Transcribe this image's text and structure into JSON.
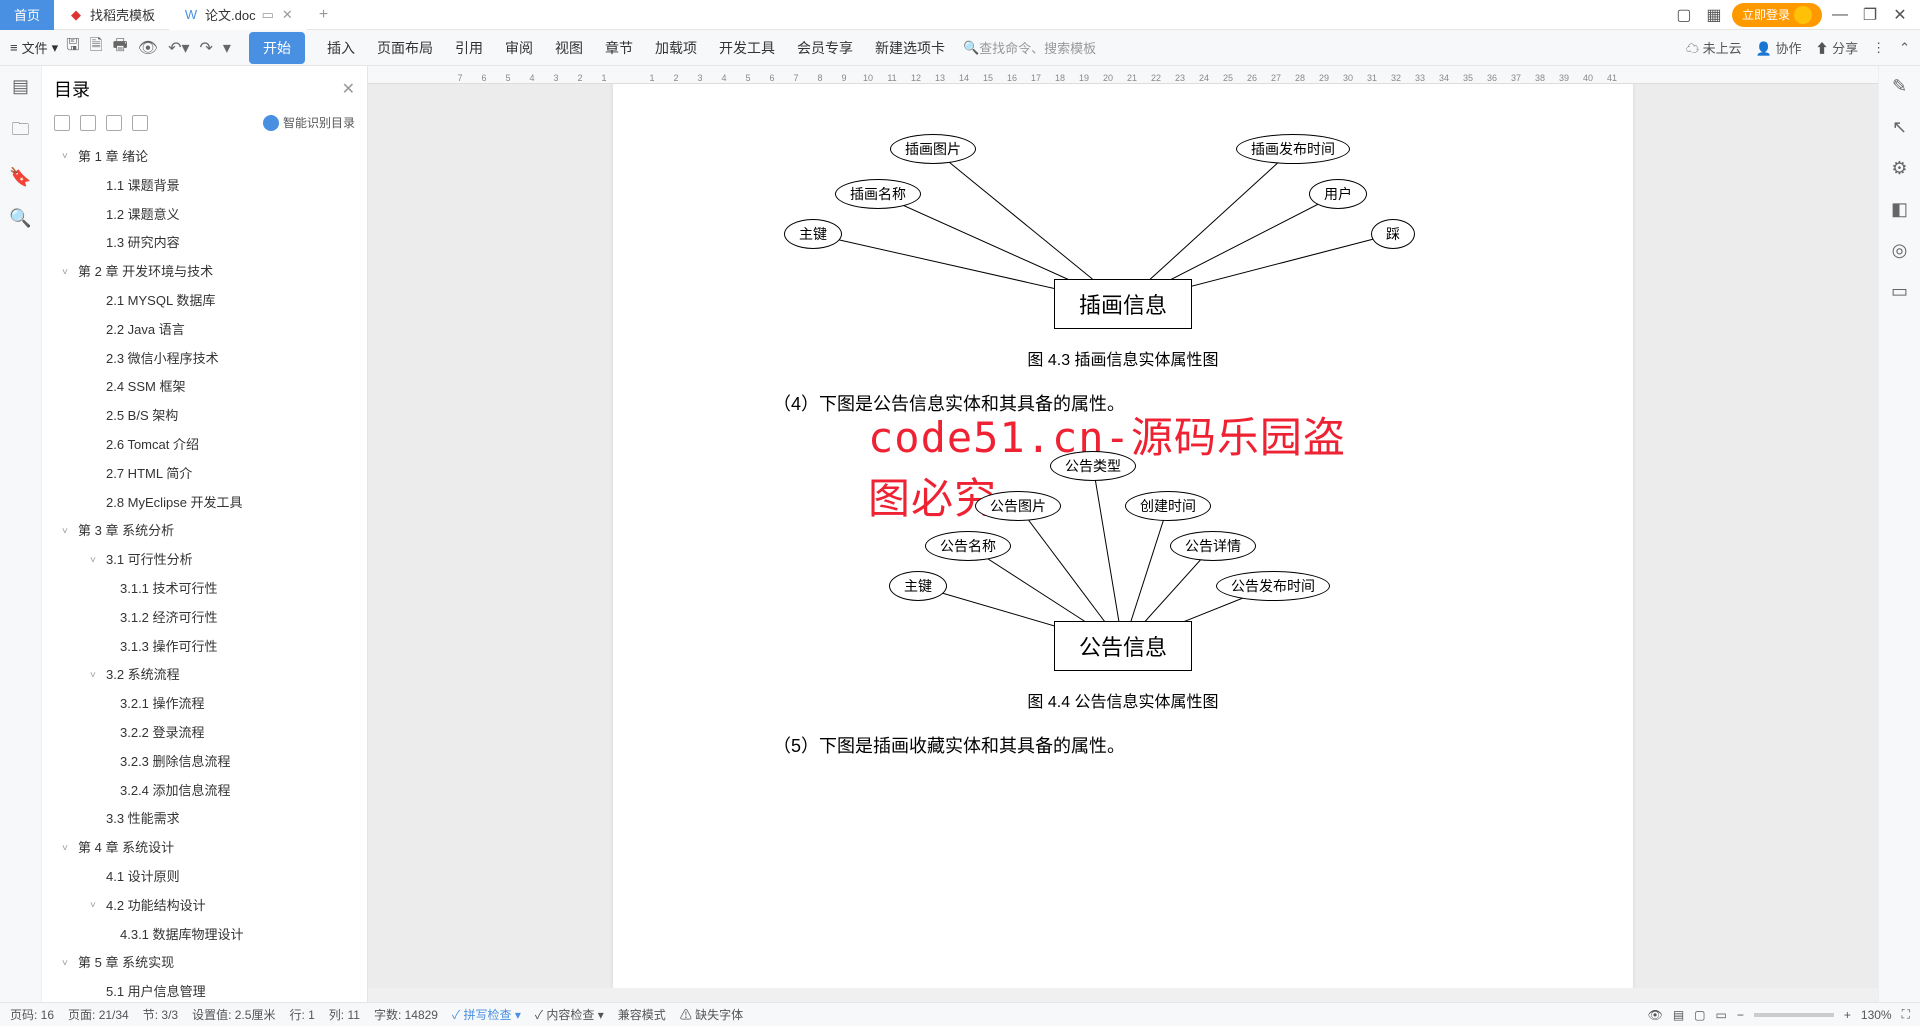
{
  "tabs": {
    "home": "首页",
    "template": "找稻壳模板",
    "doc": "论文.doc"
  },
  "login": "立即登录",
  "file": "文件",
  "ribbon": [
    "开始",
    "插入",
    "页面布局",
    "引用",
    "审阅",
    "视图",
    "章节",
    "加载项",
    "开发工具",
    "会员专享",
    "新建选项卡"
  ],
  "search_placeholder": "查找命令、搜索模板",
  "toolbar_right": {
    "cloud": "未上云",
    "collab": "协作",
    "share": "分享"
  },
  "toc": {
    "title": "目录",
    "smart": "智能识别目录",
    "items": [
      {
        "l": 1,
        "caret": true,
        "t": "第 1 章  绪论"
      },
      {
        "l": 2,
        "t": "1.1  课题背景"
      },
      {
        "l": 2,
        "t": "1.2  课题意义"
      },
      {
        "l": 2,
        "t": "1.3  研究内容"
      },
      {
        "l": 1,
        "caret": true,
        "t": "第 2 章  开发环境与技术"
      },
      {
        "l": 2,
        "t": "2.1  MYSQL 数据库"
      },
      {
        "l": 2,
        "t": "2.2  Java 语言"
      },
      {
        "l": 2,
        "t": "2.3  微信小程序技术"
      },
      {
        "l": 2,
        "t": "2.4  SSM 框架"
      },
      {
        "l": 2,
        "t": "2.5  B/S 架构"
      },
      {
        "l": 2,
        "t": "2.6  Tomcat  介绍"
      },
      {
        "l": 2,
        "t": "2.7  HTML 简介"
      },
      {
        "l": 2,
        "t": "2.8  MyEclipse 开发工具"
      },
      {
        "l": 1,
        "caret": true,
        "t": "第 3 章  系统分析"
      },
      {
        "l": 2,
        "caret": true,
        "t": "3.1  可行性分析"
      },
      {
        "l": 3,
        "t": "3.1.1  技术可行性"
      },
      {
        "l": 3,
        "t": "3.1.2  经济可行性"
      },
      {
        "l": 3,
        "t": "3.1.3  操作可行性"
      },
      {
        "l": 2,
        "caret": true,
        "t": "3.2  系统流程"
      },
      {
        "l": 3,
        "t": "3.2.1  操作流程"
      },
      {
        "l": 3,
        "t": "3.2.2  登录流程"
      },
      {
        "l": 3,
        "t": "3.2.3  删除信息流程"
      },
      {
        "l": 3,
        "t": "3.2.4  添加信息流程"
      },
      {
        "l": 2,
        "t": "3.3  性能需求"
      },
      {
        "l": 1,
        "caret": true,
        "t": "第 4 章  系统设计"
      },
      {
        "l": 2,
        "t": "4.1  设计原则"
      },
      {
        "l": 2,
        "caret": true,
        "t": "4.2  功能结构设计"
      },
      {
        "l": 3,
        "t": "4.3.1  数据库物理设计"
      },
      {
        "l": 1,
        "caret": true,
        "t": "第 5 章  系统实现"
      },
      {
        "l": 2,
        "t": "5.1  用户信息管理"
      }
    ]
  },
  "ruler": [
    "",
    "7",
    "6",
    "5",
    "4",
    "3",
    "2",
    "1",
    "",
    "1",
    "2",
    "3",
    "4",
    "5",
    "6",
    "7",
    "8",
    "9",
    "10",
    "11",
    "12",
    "13",
    "14",
    "15",
    "16",
    "17",
    "18",
    "19",
    "20",
    "21",
    "22",
    "23",
    "24",
    "25",
    "26",
    "27",
    "28",
    "29",
    "30",
    "31",
    "32",
    "33",
    "34",
    "35",
    "36",
    "37",
    "38",
    "39",
    "40",
    "41"
  ],
  "doc": {
    "watermark": "code51.cn-源码乐园盗图必究",
    "diagram1": {
      "center": "插画信息",
      "nodes": [
        "主键",
        "插画名称",
        "插画图片",
        "插画发布时间",
        "用户",
        "踩"
      ],
      "caption": "图 4.3 插画信息实体属性图"
    },
    "para4": "（4）下图是公告信息实体和其具备的属性。",
    "diagram2": {
      "center": "公告信息",
      "nodes": [
        "主键",
        "公告名称",
        "公告图片",
        "公告类型",
        "创建时间",
        "公告详情",
        "公告发布时间"
      ],
      "caption": "图 4.4 公告信息实体属性图"
    },
    "para5": "（5）下图是插画收藏实体和其具备的属性。"
  },
  "status": {
    "page_no": "页码: 16",
    "page": "页面: 21/34",
    "sec": "节: 3/3",
    "setval": "设置值: 2.5厘米",
    "row": "行: 1",
    "col": "列: 11",
    "words": "字数: 14829",
    "spell": "拼写检查",
    "content": "内容检查",
    "compat": "兼容模式",
    "missing": "缺失字体",
    "zoom": "130%"
  }
}
